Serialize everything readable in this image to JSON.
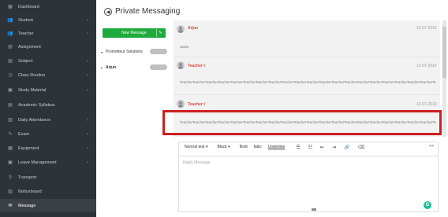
{
  "sidebar": {
    "items": [
      {
        "label": "Dashboard",
        "icon": "dashboard-icon",
        "glyph": "▦",
        "has_chevron": false
      },
      {
        "label": "Student",
        "icon": "student-icon",
        "glyph": "👥",
        "has_chevron": true
      },
      {
        "label": "Teacher",
        "icon": "teacher-icon",
        "glyph": "👥",
        "has_chevron": true
      },
      {
        "label": "Assignment",
        "icon": "assignment-icon",
        "glyph": "▤",
        "has_chevron": false
      },
      {
        "label": "Subject",
        "icon": "subject-icon",
        "glyph": "▤",
        "has_chevron": true
      },
      {
        "label": "Class Routine",
        "icon": "class-routine-icon",
        "glyph": "◷",
        "has_chevron": true
      },
      {
        "label": "Study Material",
        "icon": "study-material-icon",
        "glyph": "▣",
        "has_chevron": true
      },
      {
        "label": "Academic Syllabus",
        "icon": "syllabus-icon",
        "glyph": "▤",
        "has_chevron": false
      },
      {
        "label": "Daily Attendance",
        "icon": "attendance-icon",
        "glyph": "▥",
        "has_chevron": true
      },
      {
        "label": "Exam",
        "icon": "exam-icon",
        "glyph": "✎",
        "has_chevron": true
      },
      {
        "label": "Equipment",
        "icon": "equipment-icon",
        "glyph": "▦",
        "has_chevron": true
      },
      {
        "label": "Leave Management",
        "icon": "leave-icon",
        "glyph": "▣",
        "has_chevron": true
      },
      {
        "label": "Transport",
        "icon": "transport-icon",
        "glyph": "⚲",
        "has_chevron": false
      },
      {
        "label": "Noticeboard",
        "icon": "noticeboard-icon",
        "glyph": "▥",
        "has_chevron": false
      },
      {
        "label": "Message",
        "icon": "message-icon",
        "glyph": "✉",
        "has_chevron": false,
        "active": true
      }
    ]
  },
  "header": {
    "title": "Private Messaging",
    "back_glyph": "◀"
  },
  "compose": {
    "new_message_label": "New Message",
    "pencil_glyph": "✎"
  },
  "contacts": [
    {
      "caret": "▾",
      "name": "Prometteur Solutions"
    },
    {
      "caret": "▾",
      "name": "Arjun"
    }
  ],
  "messages": [
    {
      "sender": "Arjun",
      "date": "12-07-2019",
      "text": "qwwe"
    },
    {
      "sender": "Teacher t",
      "date": "12-07-2019",
      "text": "TeacherTeacherTeacherTeacherTeacherTeacherTeacherTeacherTeacherTeacherTeacherTeacherTeacherTeacherTeacherTeacherTeacherTeacherTeacherTeacherTeacher"
    },
    {
      "sender": "Teacher t",
      "date": "12-07-2019",
      "text": "TeacherTeacherTeacherTeacherTeacherTeacherTeacherTeacherTeacherTeacherTeacherTeacherTeacherTeacherTeacherTeacherTeacherTeacherTeacherTeacherTeacher"
    }
  ],
  "editor": {
    "format_select": "Normal text ▾",
    "color_select": "Black ▾",
    "bold": "Bold",
    "italic": "Italic",
    "underline": "Underline",
    "icons": [
      {
        "name": "unordered-list-icon",
        "glyph": "☰"
      },
      {
        "name": "ordered-list-icon",
        "glyph": "☷"
      },
      {
        "name": "outdent-icon",
        "glyph": "⇤"
      },
      {
        "name": "indent-icon",
        "glyph": "⇥"
      },
      {
        "name": "link-icon",
        "glyph": "🔗"
      },
      {
        "name": "remove-format-icon",
        "glyph": "⌫"
      }
    ],
    "code_glyph": "<>",
    "placeholder": "Reply Message",
    "grammarly_glyph": "G"
  },
  "colors": {
    "sidebar_bg": "#2e3338",
    "new_message_bg": "#1faa3d",
    "sender_color": "#e0443e",
    "highlight_border": "#cc1f1f"
  }
}
